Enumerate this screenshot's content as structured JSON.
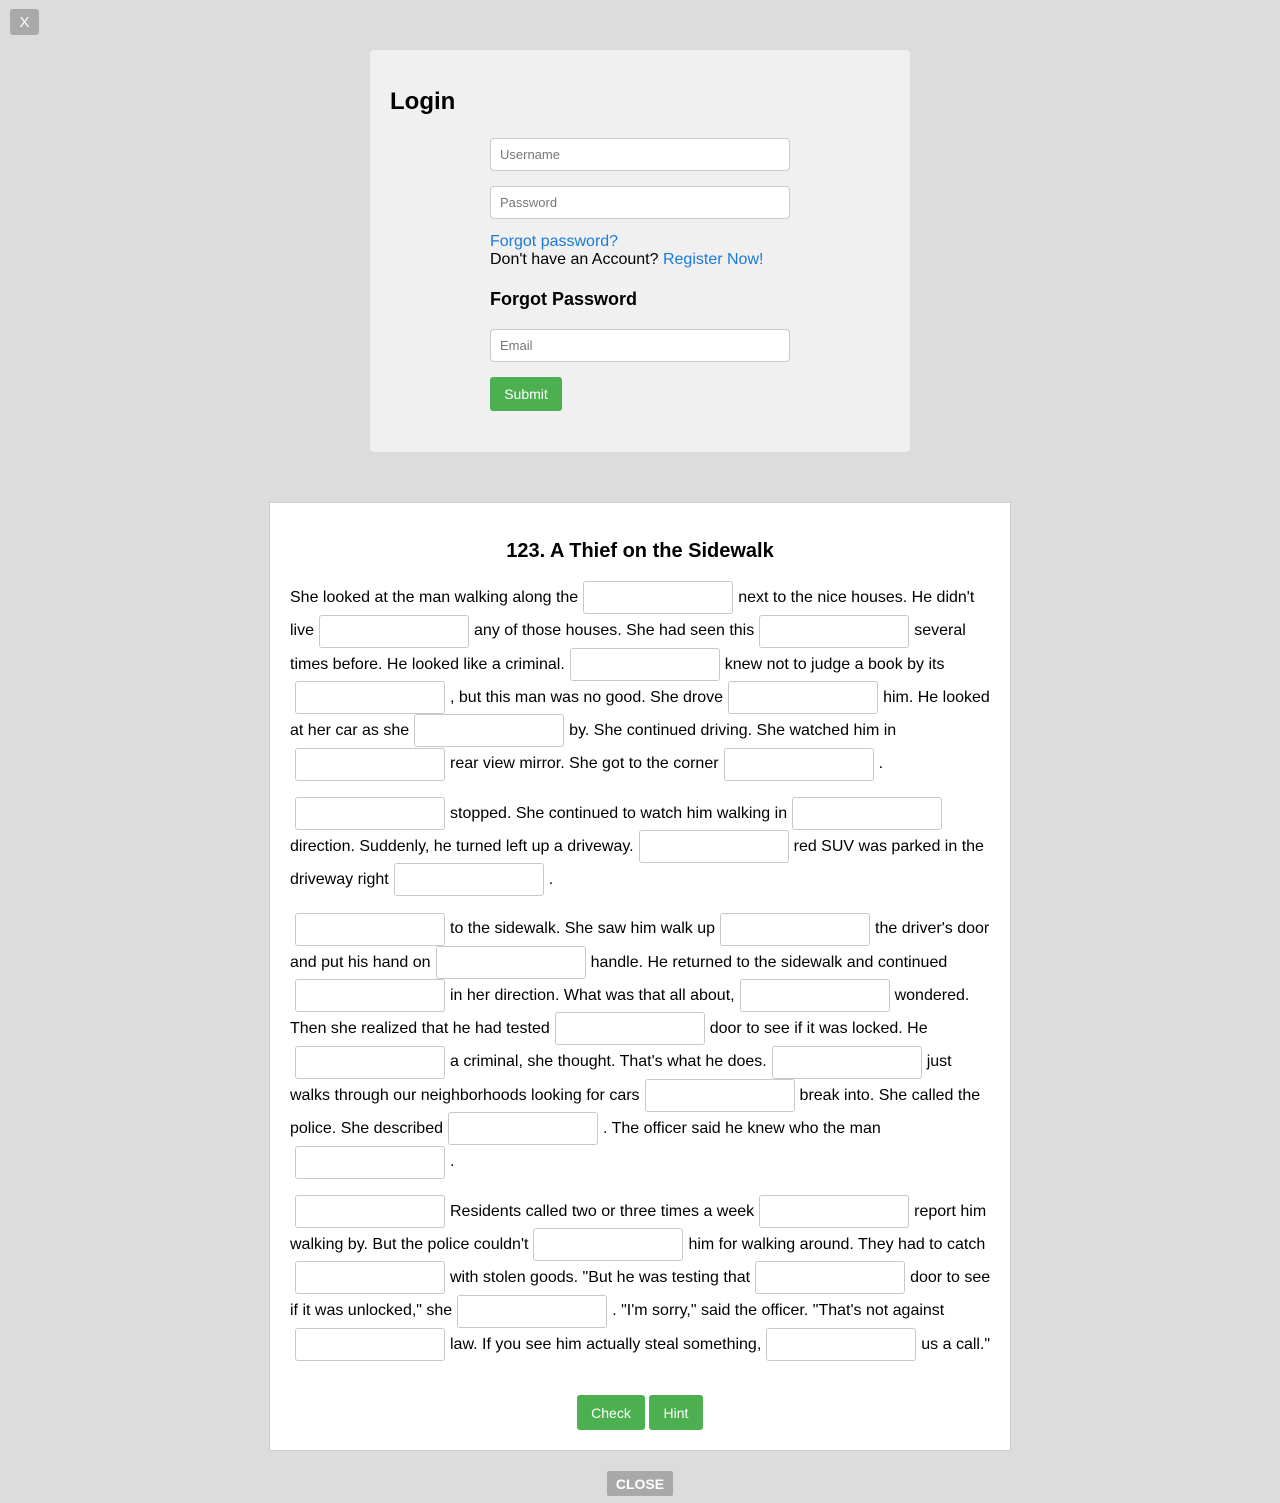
{
  "close_x_label": "X",
  "close_label": "CLOSE",
  "login": {
    "title": "Login",
    "username_placeholder": "Username",
    "password_placeholder": "Password",
    "forgot_link": "Forgot password?",
    "no_account_text": "Don't have an Account?",
    "register_link": "Register Now!",
    "forgot_title": "Forgot Password",
    "email_placeholder": "Email",
    "submit_label": "Submit"
  },
  "exercise": {
    "title": "123. A Thief on the Sidewalk",
    "paragraphs": [
      [
        "She looked at the man walking along the",
        "next to the nice houses. He didn't live",
        "any of those houses. She had seen this",
        "several times before. He looked like a criminal.",
        "knew not to judge a book by its",
        ", but this man was no good. She drove",
        "him. He looked at her car as she",
        "by. She continued driving. She watched him in",
        "rear view mirror. She got to the corner",
        "."
      ],
      [
        "",
        "stopped. She continued to watch him walking in",
        "direction. Suddenly, he turned left up a driveway.",
        "red SUV was parked in the driveway right",
        "."
      ],
      [
        "",
        "to the sidewalk. She saw him walk up",
        "the driver's door and put his hand on",
        "handle. He returned to the sidewalk and continued",
        "in her direction. What was that all about,",
        "wondered. Then she realized that he had tested",
        "door to see if it was locked. He",
        "a criminal, she thought. That's what he does.",
        "just walks through our neighborhoods looking for cars",
        "break into. She called the police. She described",
        ". The officer said he knew who the man",
        "."
      ],
      [
        "",
        "Residents called two or three times a week",
        "report him walking by. But the police couldn't",
        "him for walking around. They had to catch",
        "with stolen goods. \"But he was testing that",
        "door to see if it was unlocked,\" she",
        ". \"I'm sorry,\" said the officer. \"That's not against",
        "law. If you see him actually steal something,",
        "us a call.\""
      ]
    ],
    "check_label": "Check",
    "hint_label": "Hint"
  }
}
